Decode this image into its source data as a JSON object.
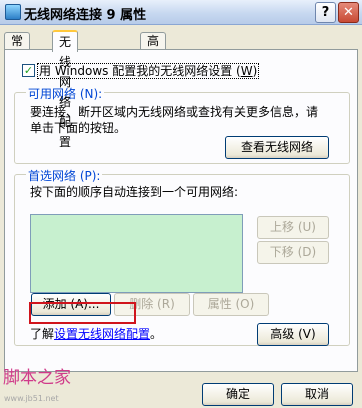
{
  "window": {
    "title": "无线网络连接 9 属性",
    "help_button": "?",
    "close_button": "✕"
  },
  "tabs": [
    {
      "label": "常规"
    },
    {
      "label": "无线网络配置"
    },
    {
      "label": "高级"
    }
  ],
  "use_windows_config": {
    "checked_glyph": "✓",
    "label_prefix": "用 Windows 配置我的无线网络设置 (",
    "accel": "W",
    "label_suffix": ")"
  },
  "available_networks": {
    "legend": "可用网络 (N):",
    "description_line1": "要连接、断开区域内无线网络或查找有关更多信息，请",
    "description_line2": "单击下面的按钮。",
    "view_button": "查看无线网络"
  },
  "preferred_networks": {
    "legend": "首选网络 (P):",
    "description": "按下面的顺序自动连接到一个可用网络:",
    "move_up_button": "上移 (U)",
    "move_down_button": "下移 (D)",
    "add_button": "添加 (A)...",
    "remove_button": "删除 (R)",
    "properties_button": "属性 (O)"
  },
  "learn_about": {
    "prefix": "了解",
    "link": "设置无线网络配置",
    "suffix": "。",
    "advanced_button": "高级 (V)"
  },
  "footer": {
    "ok_button": "确定",
    "cancel_button": "取消"
  },
  "watermark": {
    "text": "脚本之家",
    "url": "www.jb51.net"
  }
}
